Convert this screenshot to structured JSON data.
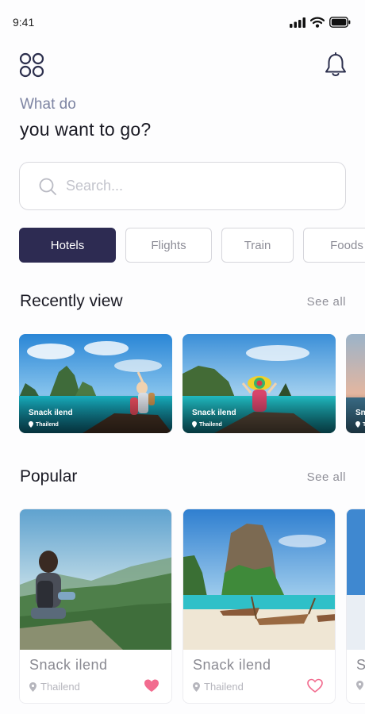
{
  "status_bar": {
    "time": "9:41"
  },
  "header": {
    "subtitle": "What do",
    "title": "you want to go?"
  },
  "search": {
    "placeholder": "Search..."
  },
  "categories": [
    {
      "label": "Hotels",
      "active": true
    },
    {
      "label": "Flights",
      "active": false
    },
    {
      "label": "Train",
      "active": false
    },
    {
      "label": "Foods",
      "active": false
    }
  ],
  "recent": {
    "title": "Recently view",
    "see_all": "See all",
    "items": [
      {
        "name": "Snack ilend",
        "location": "Thailend"
      },
      {
        "name": "Snack ilend",
        "location": "Thailend"
      },
      {
        "name": "Sn",
        "location": "T"
      }
    ]
  },
  "popular": {
    "title": "Popular",
    "see_all": "See all",
    "items": [
      {
        "name": "Snack ilend",
        "location": "Thailend",
        "favorited": true
      },
      {
        "name": "Snack ilend",
        "location": "Thailend",
        "favorited": false
      },
      {
        "name": "S",
        "location": ""
      }
    ]
  },
  "colors": {
    "accent": "#2d2b52",
    "heart": "#f26c8f",
    "muted": "#8f8f98"
  },
  "icons": [
    "signal-icon",
    "wifi-icon",
    "battery-icon",
    "menu-grid-icon",
    "bell-icon",
    "search-icon",
    "location-pin-icon",
    "heart-icon"
  ]
}
